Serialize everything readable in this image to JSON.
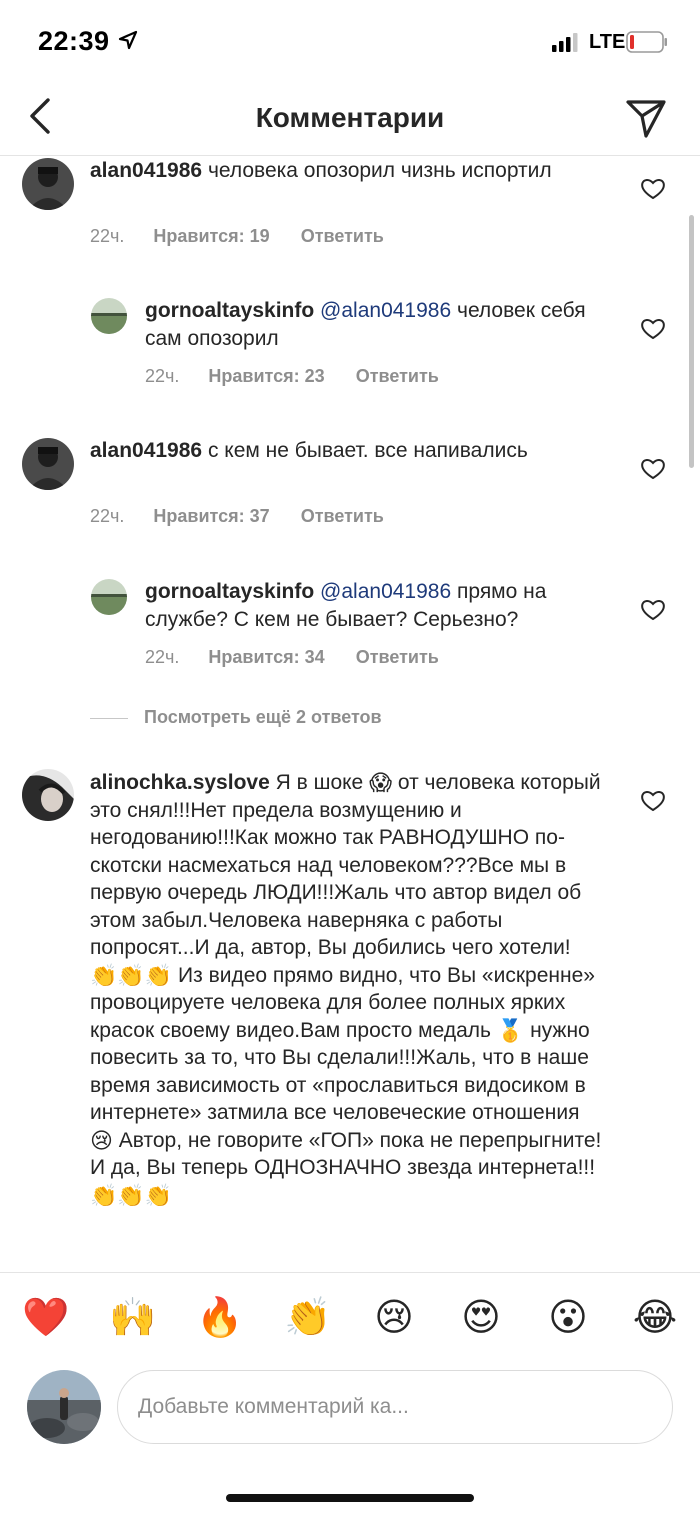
{
  "status": {
    "time": "22:39",
    "network": "LTE",
    "battery_color": "#e0302b"
  },
  "header": {
    "title": "Комментарии"
  },
  "comments": [
    {
      "username": "alan041986",
      "mention": "",
      "text": "человека опозорил чизнь испортил",
      "time": "22ч.",
      "likes": "Нравится: 19",
      "reply": "Ответить"
    },
    {
      "username": "gornoaltayskinfo",
      "mention": "@alan041986",
      "text": "человек себя сам опозорил",
      "time": "22ч.",
      "likes": "Нравится: 23",
      "reply": "Ответить"
    },
    {
      "username": "alan041986",
      "mention": "",
      "text": "с кем не бывает. все напивались",
      "time": "22ч.",
      "likes": "Нравится: 37",
      "reply": "Ответить"
    },
    {
      "username": "gornoaltayskinfo",
      "mention": "@alan041986",
      "text": "прямо на службе? С кем не бывает? Серьезно?",
      "time": "22ч.",
      "likes": "Нравится: 34",
      "reply": "Ответить"
    }
  ],
  "more_replies": "Посмотреть ещё 2 ответов",
  "long_comment": {
    "username": "alinochka.syslove",
    "part1": "Я в шоке",
    "emoji1": "😱",
    "part2": "от человека который это снял!!!Нет предела возмущению и негодованию!!!Как можно так РАВНОДУШНО по-скотски насмехаться над человеком???Все мы в первую очередь ЛЮДИ!!!Жаль что автор видел об этом забыл.Человека наверняка с работы попросят...И да, автор, Вы добились чего хотели!",
    "emoji2": "👏👏👏",
    "part3": "Из видео прямо видно, что Вы «искренне» провоцируете человека для более полных ярких красок своему видео.Вам просто медаль",
    "emoji3": "🥇",
    "part4": "нужно повесить за то, что Вы сделали!!!Жаль, что в наше время зависимость от «прославиться видосиком в интернете» затмила все человеческие отношения",
    "emoji4": "😢",
    "part5": "Автор, не говорите «ГОП» пока не перепрыгните!И да, Вы теперь ОДНОЗНАЧНО звезда интернета!!!",
    "emoji5": "👏👏👏"
  },
  "emoji_bar": [
    "❤️",
    "🙌",
    "🔥",
    "👏",
    "😢",
    "😍",
    "😮",
    "😂"
  ],
  "composer": {
    "placeholder": "Добавьте комментарий ка..."
  }
}
